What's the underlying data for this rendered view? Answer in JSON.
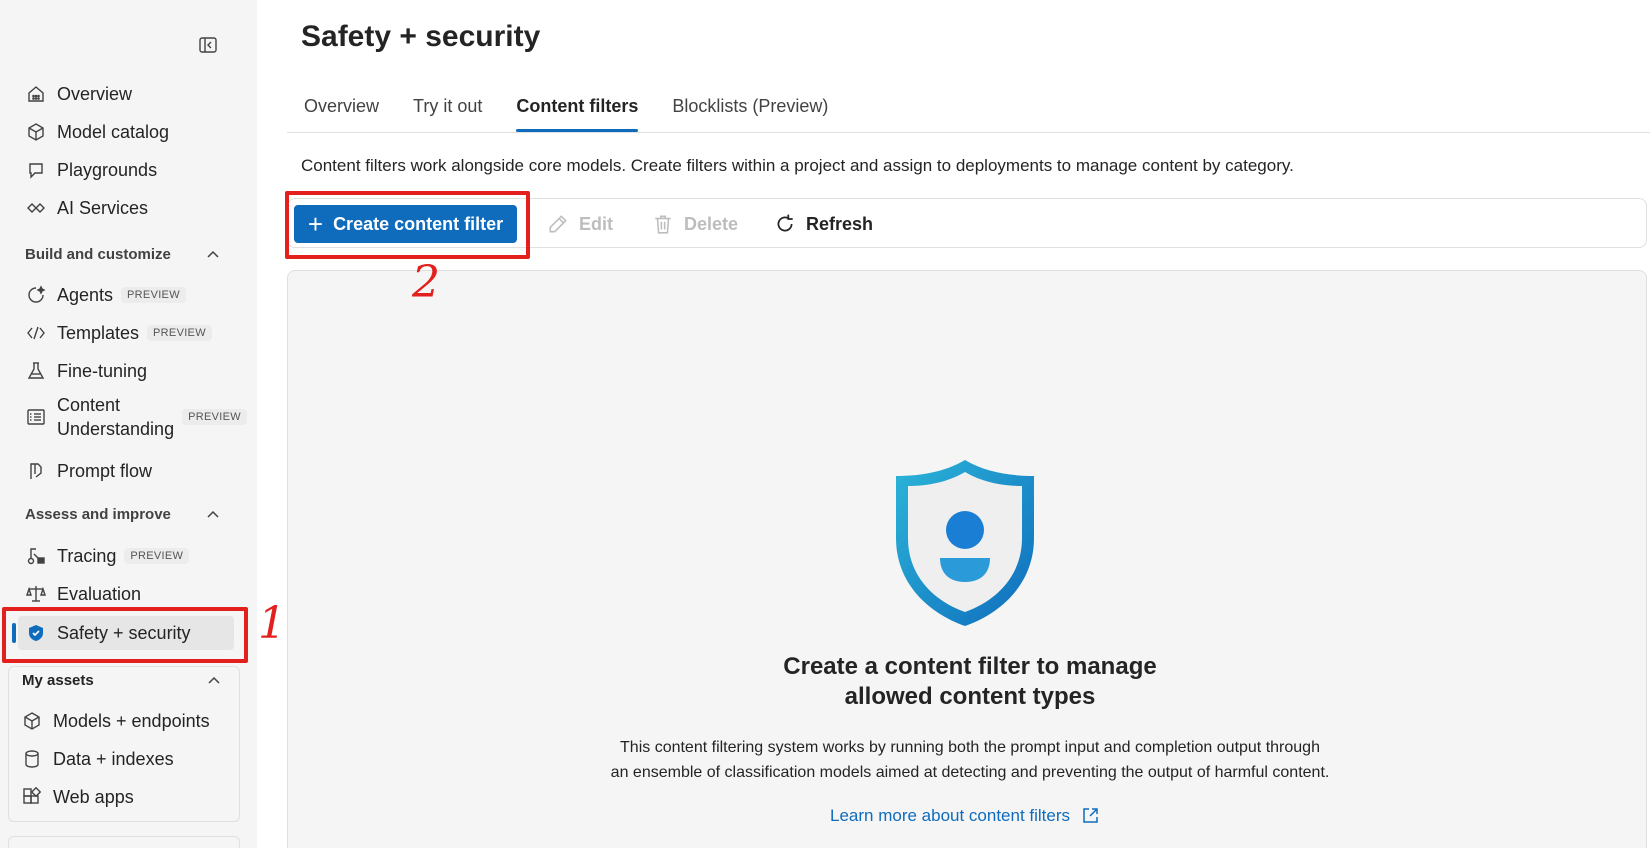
{
  "sidebar": {
    "collapse_icon": "collapse-panel-icon",
    "items_top": [
      {
        "label": "Overview",
        "icon": "grid-icon"
      },
      {
        "label": "Model catalog",
        "icon": "cube-icon"
      },
      {
        "label": "Playgrounds",
        "icon": "chat-icon"
      },
      {
        "label": "AI Services",
        "icon": "link-icon"
      }
    ],
    "section_build": "Build and customize",
    "items_build": [
      {
        "label": "Agents",
        "badge": "PREVIEW",
        "icon": "agent-icon"
      },
      {
        "label": "Templates",
        "badge": "PREVIEW",
        "icon": "code-icon"
      },
      {
        "label": "Fine-tuning",
        "icon": "flask-icon"
      },
      {
        "label_line1": "Content",
        "label_line2": "Understanding",
        "badge": "PREVIEW",
        "icon": "document-list-icon"
      },
      {
        "label": "Prompt flow",
        "icon": "flow-icon"
      }
    ],
    "section_assess": "Assess and improve",
    "items_assess": [
      {
        "label": "Tracing",
        "badge": "PREVIEW",
        "icon": "tracing-icon"
      },
      {
        "label": "Evaluation",
        "icon": "scale-icon"
      },
      {
        "label": "Safety + security",
        "icon": "shield-icon",
        "active": true
      }
    ],
    "section_assets": "My assets",
    "items_assets": [
      {
        "label": "Models + endpoints",
        "icon": "cube-outline-icon"
      },
      {
        "label": "Data + indexes",
        "icon": "database-icon"
      },
      {
        "label": "Web apps",
        "icon": "apps-icon"
      }
    ]
  },
  "main": {
    "title": "Safety + security",
    "tabs": [
      {
        "label": "Overview"
      },
      {
        "label": "Try it out"
      },
      {
        "label": "Content filters",
        "active": true
      },
      {
        "label": "Blocklists (Preview)"
      }
    ],
    "description": "Content filters work alongside core models. Create filters within a project and assign to deployments to manage content by category.",
    "toolbar": {
      "create_label": "Create content filter",
      "edit_label": "Edit",
      "delete_label": "Delete",
      "refresh_label": "Refresh"
    },
    "empty_state": {
      "title_line1": "Create a content filter to manage",
      "title_line2": "allowed content types",
      "body_line1": "This content filtering system works by running both the prompt input and completion output through",
      "body_line2": "an ensemble of classification models aimed at detecting and preventing the output of harmful content.",
      "link": "Learn more about content filters"
    }
  },
  "annotations": {
    "marker1": "1",
    "marker2": "2"
  },
  "colors": {
    "accent": "#0f6cbd",
    "highlight": "#e2201e",
    "sidebar_bg": "#f5f5f5"
  }
}
